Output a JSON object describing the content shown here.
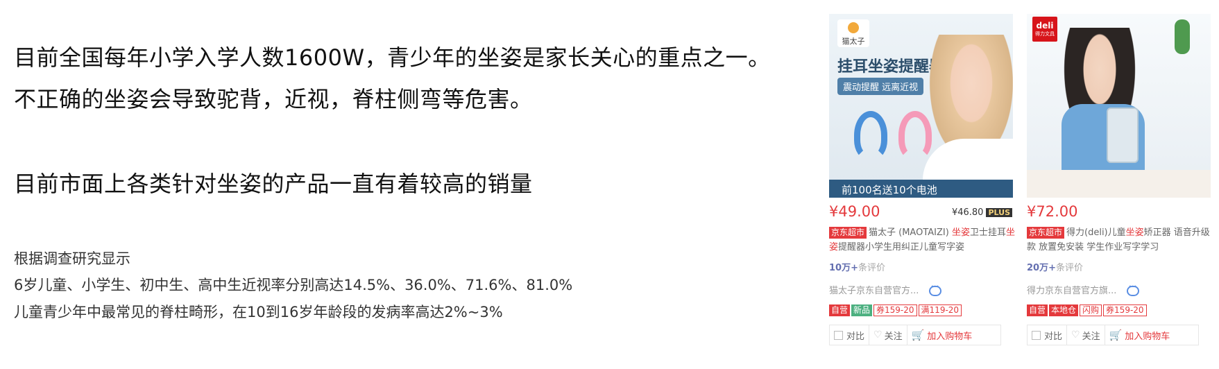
{
  "slide": {
    "headlines": [
      "目前全国每年小学入学人数1600W，青少年的坐姿是家长关心的重点之一。",
      "不正确的坐姿会导致驼背，近视，脊柱侧弯等危害。",
      "目前市面上各类针对坐姿的产品一直有着较高的销量"
    ],
    "research": [
      "根据调查研究显示",
      "6岁儿童、小学生、初中生、高中生近视率分别高达14.5%、36.0%、71.6%、81.0%",
      "儿童青少年中最常见的脊柱畸形，在10到16岁年龄段的发病率高达2%~3%"
    ]
  },
  "products": [
    {
      "image": {
        "brand": "猫太子",
        "title": "挂耳坐姿提醒器",
        "banner": "震动提醒 远离近视",
        "bottom_banner": "前100名送10个电池"
      },
      "price": "¥49.00",
      "plus_price": "¥46.80",
      "plus_label": "PLUS",
      "store_tag": "京东超市",
      "title_before": "猫太子 (MAOTAIZI) ",
      "title_hl1": "坐姿",
      "title_mid": "卫士挂耳",
      "title_hl2": "坐姿",
      "title_after": "提醒器小学生用纠正儿童写字姿",
      "comment_count": "10万+",
      "comment_label": "条评价",
      "shop": "猫太子京东自营官方...",
      "tags": [
        "自营",
        "新品",
        "券159-20",
        "满119-20"
      ],
      "actions": {
        "compare": "对比",
        "follow": "关注",
        "cart": "加入购物车"
      },
      "accent": "#e4393c"
    },
    {
      "image": {
        "brand": "deli",
        "brand_sub": "得力文具"
      },
      "price": "¥72.00",
      "store_tag": "京东超市",
      "title_before": "得力(deli)儿童",
      "title_hl1": "坐姿",
      "title_after": "矫正器 语音升级款 放置免安装 学生作业写字学习",
      "comment_count": "20万+",
      "comment_label": "条评价",
      "shop": "得力京东自营官方旗...",
      "tags": [
        "自营",
        "本地仓",
        "闪购",
        "券159-20"
      ],
      "actions": {
        "compare": "对比",
        "follow": "关注",
        "cart": "加入购物车"
      },
      "accent": "#e4393c"
    }
  ]
}
